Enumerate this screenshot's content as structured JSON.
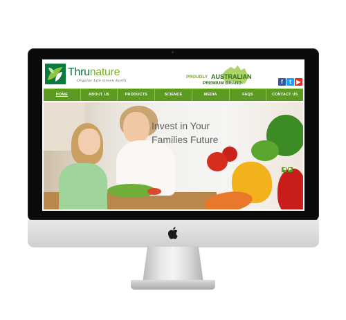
{
  "site": {
    "logo_name_main": "Thru",
    "logo_name_accent": "nature",
    "tagline": "Organic Life Green Earth"
  },
  "premium_badge": {
    "proudly": "PROUDLY",
    "australian": "AUSTRALIAN",
    "premium_brand": "PREMIUM BRAND",
    "color": "#2f6a1a"
  },
  "social": {
    "facebook": "f",
    "twitter": "t",
    "youtube": "▶"
  },
  "nav": {
    "items": [
      {
        "label": "HOME",
        "active": true
      },
      {
        "label": "ABOUT US"
      },
      {
        "label": "PRODUCTS"
      },
      {
        "label": "SCIENCE"
      },
      {
        "label": "MEDIA"
      },
      {
        "label": "FAQS"
      },
      {
        "label": "CONTACT US"
      }
    ],
    "color": "#5b9b21"
  },
  "hero": {
    "line1": "Invest in Your",
    "line2": "Families Future",
    "prev_arrow": "◀",
    "next_arrow": "▶"
  },
  "icons": [
    "apple-logo-icon",
    "facebook-icon",
    "twitter-icon",
    "youtube-icon",
    "leaf-logo-icon",
    "australia-map-icon"
  ]
}
